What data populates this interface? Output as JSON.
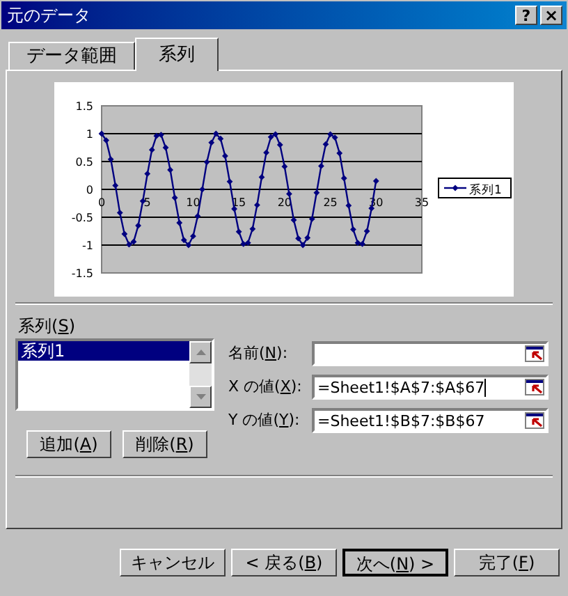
{
  "window": {
    "title": "元のデータ",
    "help": "?",
    "close": "×"
  },
  "tabs": [
    {
      "label": "データ範囲",
      "selected": false
    },
    {
      "label": "系列",
      "selected": true
    }
  ],
  "chart_data": {
    "type": "line",
    "x": [
      0,
      0.5,
      1,
      1.5,
      2,
      2.5,
      3,
      3.5,
      4,
      4.5,
      5,
      5.5,
      6,
      6.5,
      7,
      7.5,
      8,
      8.5,
      9,
      9.5,
      10,
      10.5,
      11,
      11.5,
      12,
      12.5,
      13,
      13.5,
      14,
      14.5,
      15,
      15.5,
      16,
      16.5,
      17,
      17.5,
      18,
      18.5,
      19,
      19.5,
      20,
      20.5,
      21,
      21.5,
      22,
      22.5,
      23,
      23.5,
      24,
      24.5,
      25,
      25.5,
      26,
      26.5,
      27,
      27.5,
      28,
      28.5,
      29,
      29.5,
      30
    ],
    "series": [
      {
        "name": "系列1",
        "color": "#000080",
        "marker": "diamond",
        "values": [
          1,
          0.88,
          0.54,
          0.07,
          -0.42,
          -0.8,
          -0.99,
          -0.94,
          -0.65,
          -0.21,
          0.28,
          0.71,
          0.96,
          0.98,
          0.75,
          0.35,
          -0.15,
          -0.6,
          -0.91,
          -1,
          -0.84,
          -0.48,
          0,
          0.49,
          0.84,
          1,
          0.91,
          0.6,
          0.14,
          -0.35,
          -0.76,
          -0.98,
          -0.96,
          -0.71,
          -0.28,
          0.22,
          0.66,
          0.94,
          0.99,
          0.8,
          0.41,
          -0.08,
          -0.55,
          -0.88,
          -1,
          -0.87,
          -0.53,
          -0.06,
          0.42,
          0.81,
          0.99,
          0.93,
          0.65,
          0.2,
          -0.29,
          -0.72,
          -0.96,
          -0.98,
          -0.75,
          -0.34,
          0.15
        ]
      }
    ],
    "grid": true,
    "xlim": [
      0,
      35
    ],
    "ylim": [
      -1.5,
      1.5
    ],
    "xticks": [
      0,
      5,
      10,
      15,
      20,
      25,
      30,
      35
    ],
    "yticks": [
      1.5,
      1,
      0.5,
      0,
      -0.5,
      -1,
      -1.5
    ]
  },
  "series_list": {
    "label": {
      "pre": "系列(",
      "key": "S",
      "post": ")"
    },
    "items": [
      {
        "label": "系列1",
        "selected": true
      }
    ]
  },
  "fields": [
    {
      "label": {
        "pre": "名前(",
        "key": "N",
        "post": "):"
      },
      "focused": false
    },
    {
      "label": {
        "pre": "X の値(",
        "key": "X",
        "post": "):"
      },
      "value": "=Sheet1!$A$7:$A$67",
      "focused": true
    },
    {
      "label": {
        "pre": "Y の値(",
        "key": "Y",
        "post": "):"
      },
      "value": "=Sheet1!$B$7:$B$67",
      "focused": false
    }
  ],
  "list_buttons": [
    {
      "label": {
        "pre": "追加(",
        "key": "A",
        "post": ")"
      }
    },
    {
      "label": {
        "pre": "削除(",
        "key": "R",
        "post": ")"
      }
    }
  ],
  "footer_buttons": [
    {
      "label": {
        "pre": "キャンセル"
      },
      "default": false
    },
    {
      "label": {
        "pre": "< 戻る(",
        "key": "B",
        "post": ")"
      },
      "default": false
    },
    {
      "label": {
        "pre": "次へ(",
        "key": "N",
        "post": ") >"
      },
      "default": true
    },
    {
      "label": {
        "pre": "完了(",
        "key": "F",
        "post": ")"
      },
      "default": false
    }
  ]
}
